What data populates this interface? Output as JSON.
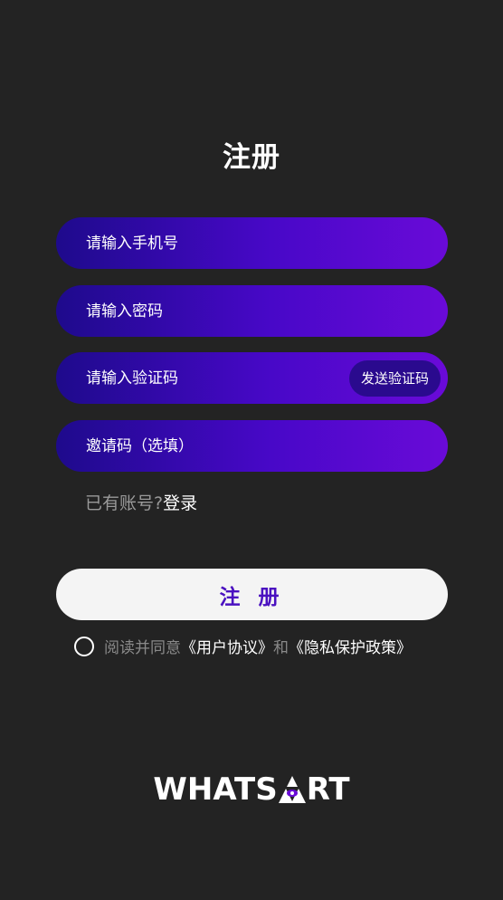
{
  "page": {
    "title": "注册"
  },
  "form": {
    "phone_placeholder": "请输入手机号",
    "password_placeholder": "请输入密码",
    "code_placeholder": "请输入验证码",
    "send_code_label": "发送验证码",
    "invite_placeholder": "邀请码（选填）"
  },
  "login": {
    "hint": "已有账号?",
    "link": "登录"
  },
  "submit_label": "注 册",
  "agreement": {
    "prefix": "阅读并同意",
    "user_agreement": "《用户协议》",
    "conjunction": "和",
    "privacy_policy": "《隐私保护政策》"
  },
  "brand": {
    "left": "WHATS",
    "right": "RT",
    "logo_icon": "triangle-eye-icon"
  },
  "colors": {
    "background": "#232323",
    "field_gradient_start": "#1e0a8c",
    "field_gradient_end": "#6a0ad8",
    "submit_text": "#4a10c0"
  }
}
